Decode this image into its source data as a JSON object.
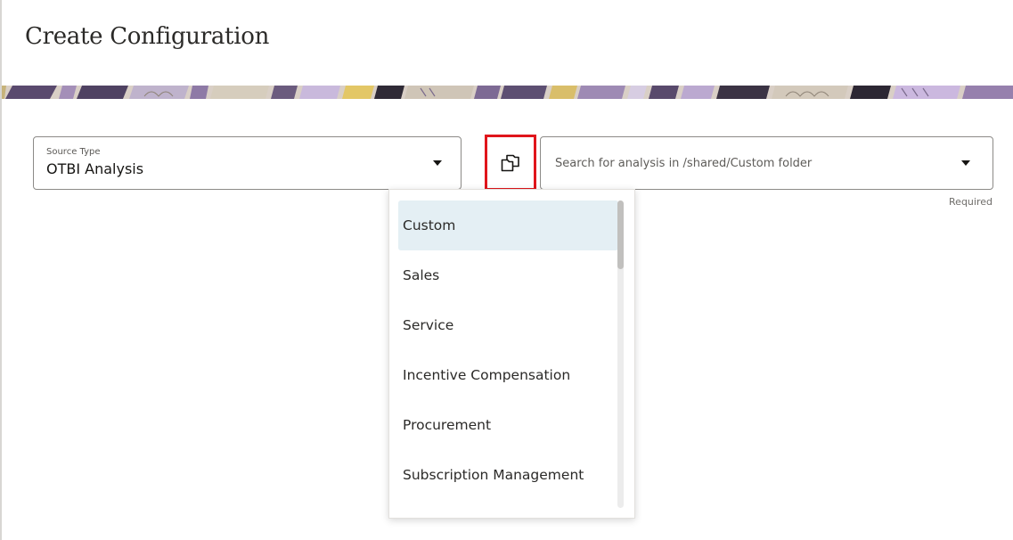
{
  "page": {
    "title": "Create Configuration"
  },
  "source_type": {
    "label": "Source Type",
    "value": "OTBI Analysis",
    "icon": "chevron-down-icon"
  },
  "folder_button": {
    "icon": "folder-browse-icon",
    "highlight_color": "#e0151b"
  },
  "analysis_search": {
    "placeholder": "Search for analysis in /shared/Custom folder",
    "value": "",
    "icon": "chevron-down-icon",
    "helper_text": "Required"
  },
  "folder_dropdown": {
    "items": [
      {
        "label": "Custom",
        "selected": true
      },
      {
        "label": "Sales",
        "selected": false
      },
      {
        "label": "Service",
        "selected": false
      },
      {
        "label": "Incentive Compensation",
        "selected": false
      },
      {
        "label": "Procurement",
        "selected": false
      },
      {
        "label": "Subscription Management",
        "selected": false
      }
    ],
    "selected_color": "#e4eff4"
  }
}
